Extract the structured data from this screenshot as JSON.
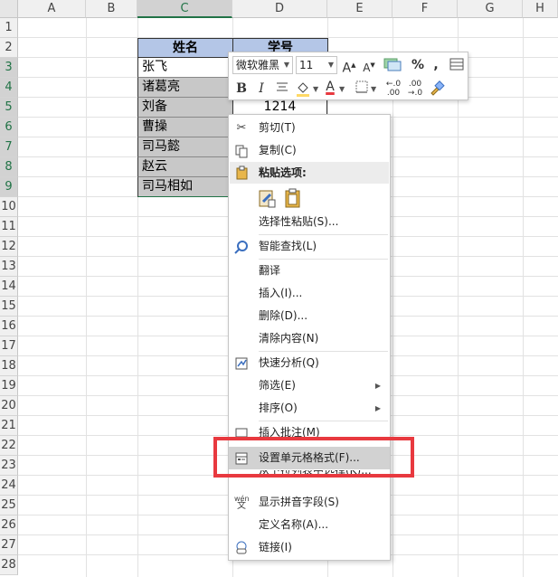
{
  "columns": [
    "A",
    "B",
    "C",
    "D",
    "E",
    "F",
    "G",
    "H"
  ],
  "rows": [
    "1",
    "2",
    "3",
    "4",
    "5",
    "6",
    "7",
    "8",
    "9",
    "10",
    "11",
    "12",
    "13",
    "14",
    "15",
    "16",
    "17",
    "18",
    "19",
    "20",
    "21",
    "22",
    "23",
    "24",
    "25",
    "26",
    "27",
    "28"
  ],
  "table": {
    "headers": [
      "姓名",
      "学号"
    ],
    "names": [
      "张飞",
      "诸葛亮",
      "刘备",
      "曹操",
      "司马懿",
      "赵云",
      "司马相如"
    ],
    "id_value": "1214"
  },
  "mini_toolbar": {
    "font_name": "微软雅黑",
    "font_size": "11",
    "grow_font": "A",
    "shrink_font": "A",
    "percent": "%",
    "comma": ",",
    "bold": "B",
    "italic": "I",
    "font_color_letter": "A",
    "font_color": "#e8393f",
    "fill_color": "#ffd966"
  },
  "context_menu": {
    "cut": "剪切(T)",
    "copy": "复制(C)",
    "paste_options": "粘贴选项:",
    "paste_special": "选择性粘贴(S)...",
    "smart_lookup": "智能查找(L)",
    "translate": "翻译",
    "insert": "插入(I)...",
    "delete": "删除(D)...",
    "clear_contents": "清除内容(N)",
    "quick_analysis": "快速分析(Q)",
    "filter": "筛选(E)",
    "sort": "排序(O)",
    "insert_comment": "插入批注(M)",
    "format_cells": "设置单元格格式(F)...",
    "pick_from_list": "从下拉列表中选择(K)...",
    "show_phonetic": "显示拼音字段(S)",
    "define_name": "定义名称(A)...",
    "link": "链接(I)"
  },
  "colors": {
    "header_fill": "#b4c6e7",
    "selection_fill": "#c8c8c8",
    "highlight_border": "#e8393f",
    "excel_green": "#217346"
  }
}
